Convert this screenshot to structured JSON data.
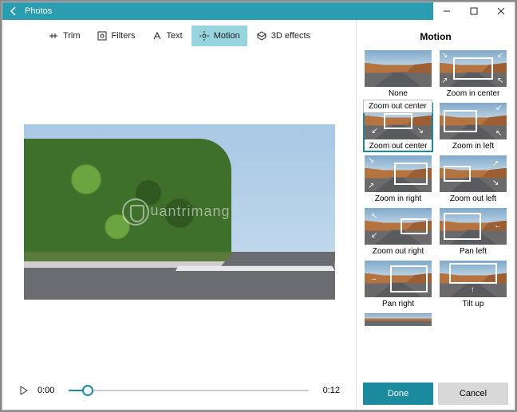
{
  "app": {
    "title": "Photos"
  },
  "toolbar": {
    "items": [
      {
        "label": "Trim"
      },
      {
        "label": "Filters"
      },
      {
        "label": "Text"
      },
      {
        "label": "Motion"
      },
      {
        "label": "3D effects"
      }
    ],
    "active": "Motion"
  },
  "player": {
    "current_time": "0:00",
    "duration": "0:12"
  },
  "panel": {
    "title": "Motion",
    "tooltip": "Zoom out center",
    "selected": "Zoom out center",
    "effects": [
      "None",
      "Zoom in center",
      "Zoom out center",
      "Zoom in left",
      "Zoom in right",
      "Zoom out left",
      "Zoom out right",
      "Pan left",
      "Pan right",
      "Tilt up"
    ],
    "done": "Done",
    "cancel": "Cancel"
  },
  "watermark": "Quản trị mạng"
}
